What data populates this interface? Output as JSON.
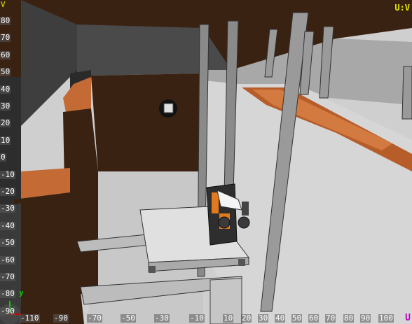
{
  "overlay": {
    "top_left_label": "V",
    "top_right_label": "U:V",
    "bottom_right_label": "U",
    "gizmo_y_label": "y"
  },
  "x_ticks": [
    "-110",
    "-90",
    "-70",
    "-50",
    "-30",
    "-10",
    "10",
    "20",
    "30",
    "40",
    "50",
    "60",
    "70",
    "80",
    "90",
    "100"
  ],
  "y_ticks": [
    "80",
    "70",
    "60",
    "50",
    "40",
    "30",
    "20",
    "10",
    "0",
    "-10",
    "-20",
    "-30",
    "-40",
    "-50",
    "-60",
    "-70",
    "-80",
    "-90"
  ],
  "colors": {
    "ceiling": "#3b2314",
    "wall_dark": "#4a4a4a",
    "floor": "#d0d0d0",
    "orange_beam": "#c1692e",
    "platform": "#dcdcdc",
    "camera_body": "#2e2e2e",
    "orange_parts": "#e07a1c"
  }
}
